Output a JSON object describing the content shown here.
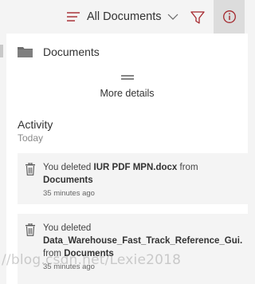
{
  "toolbar": {
    "view_label": "All Documents",
    "view_icon": "lines-icon",
    "filter_icon": "filter-icon",
    "info_icon": "info-icon"
  },
  "pane": {
    "title": "Documents",
    "more_details": "More details",
    "activity": {
      "title": "Activity",
      "subtitle": "Today",
      "items": [
        {
          "prefix": "You deleted ",
          "file": "IUR PDF MPN.docx",
          "from_word": " from",
          "location": "Documents",
          "time": "35 minutes ago"
        },
        {
          "prefix": "You deleted",
          "file": "Data_Warehouse_Fast_Track_Reference_Gui...",
          "from_word": "from ",
          "location": "Documents",
          "time": "35 minutes ago"
        }
      ]
    }
  },
  "watermark": "//blog.csdn.net/Lexie2018",
  "colors": {
    "accent": "#a4262c",
    "background": "#f4f4f4",
    "pane": "#ffffff",
    "selected_button": "#dcdcdc"
  }
}
